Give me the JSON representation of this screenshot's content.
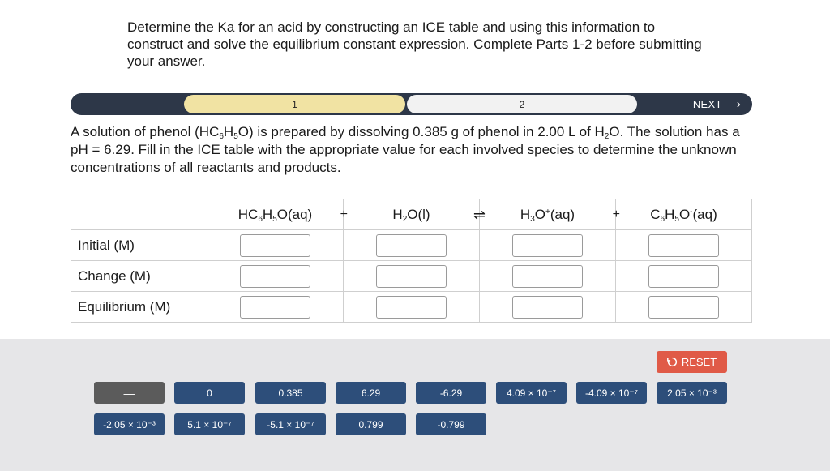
{
  "instructions": "Determine the Ka for an acid by constructing an ICE table and using this information to construct and solve the equilibrium constant expression. Complete Parts 1-2 before submitting your answer.",
  "progress": {
    "step1": "1",
    "step2": "2",
    "next": "NEXT",
    "next_chevron": "›"
  },
  "question": {
    "t1": "A solution of phenol (HC",
    "s1": "6",
    "t2": "H",
    "s2": "5",
    "t3": "O) is prepared by dissolving 0.385 g of phenol in 2.00 L of H",
    "s3": "2",
    "t4": "O. The solution has a pH = 6.29. Fill in the ICE table with the appropriate value for each involved species to determine the unknown concentrations of all reactants and products."
  },
  "table": {
    "rows": [
      "Initial (M)",
      "Change (M)",
      "Equilibrium (M)"
    ],
    "plus": "+",
    "arrow": "⇌"
  },
  "reset_label": "RESET",
  "tiles": [
    "—",
    "0",
    "0.385",
    "6.29",
    "-6.29",
    "4.09 × 10⁻⁷",
    "-4.09 × 10⁻⁷",
    "2.05 × 10⁻³",
    "-2.05 × 10⁻³",
    "5.1 × 10⁻⁷",
    "-5.1 × 10⁻⁷",
    "0.799",
    "-0.799"
  ],
  "colors": {
    "progress_bg": "#2d3748",
    "step1": "#f1e3a3",
    "tile": "#2d4e7a",
    "reset": "#e05a47",
    "tray": "#e6e6e8"
  }
}
